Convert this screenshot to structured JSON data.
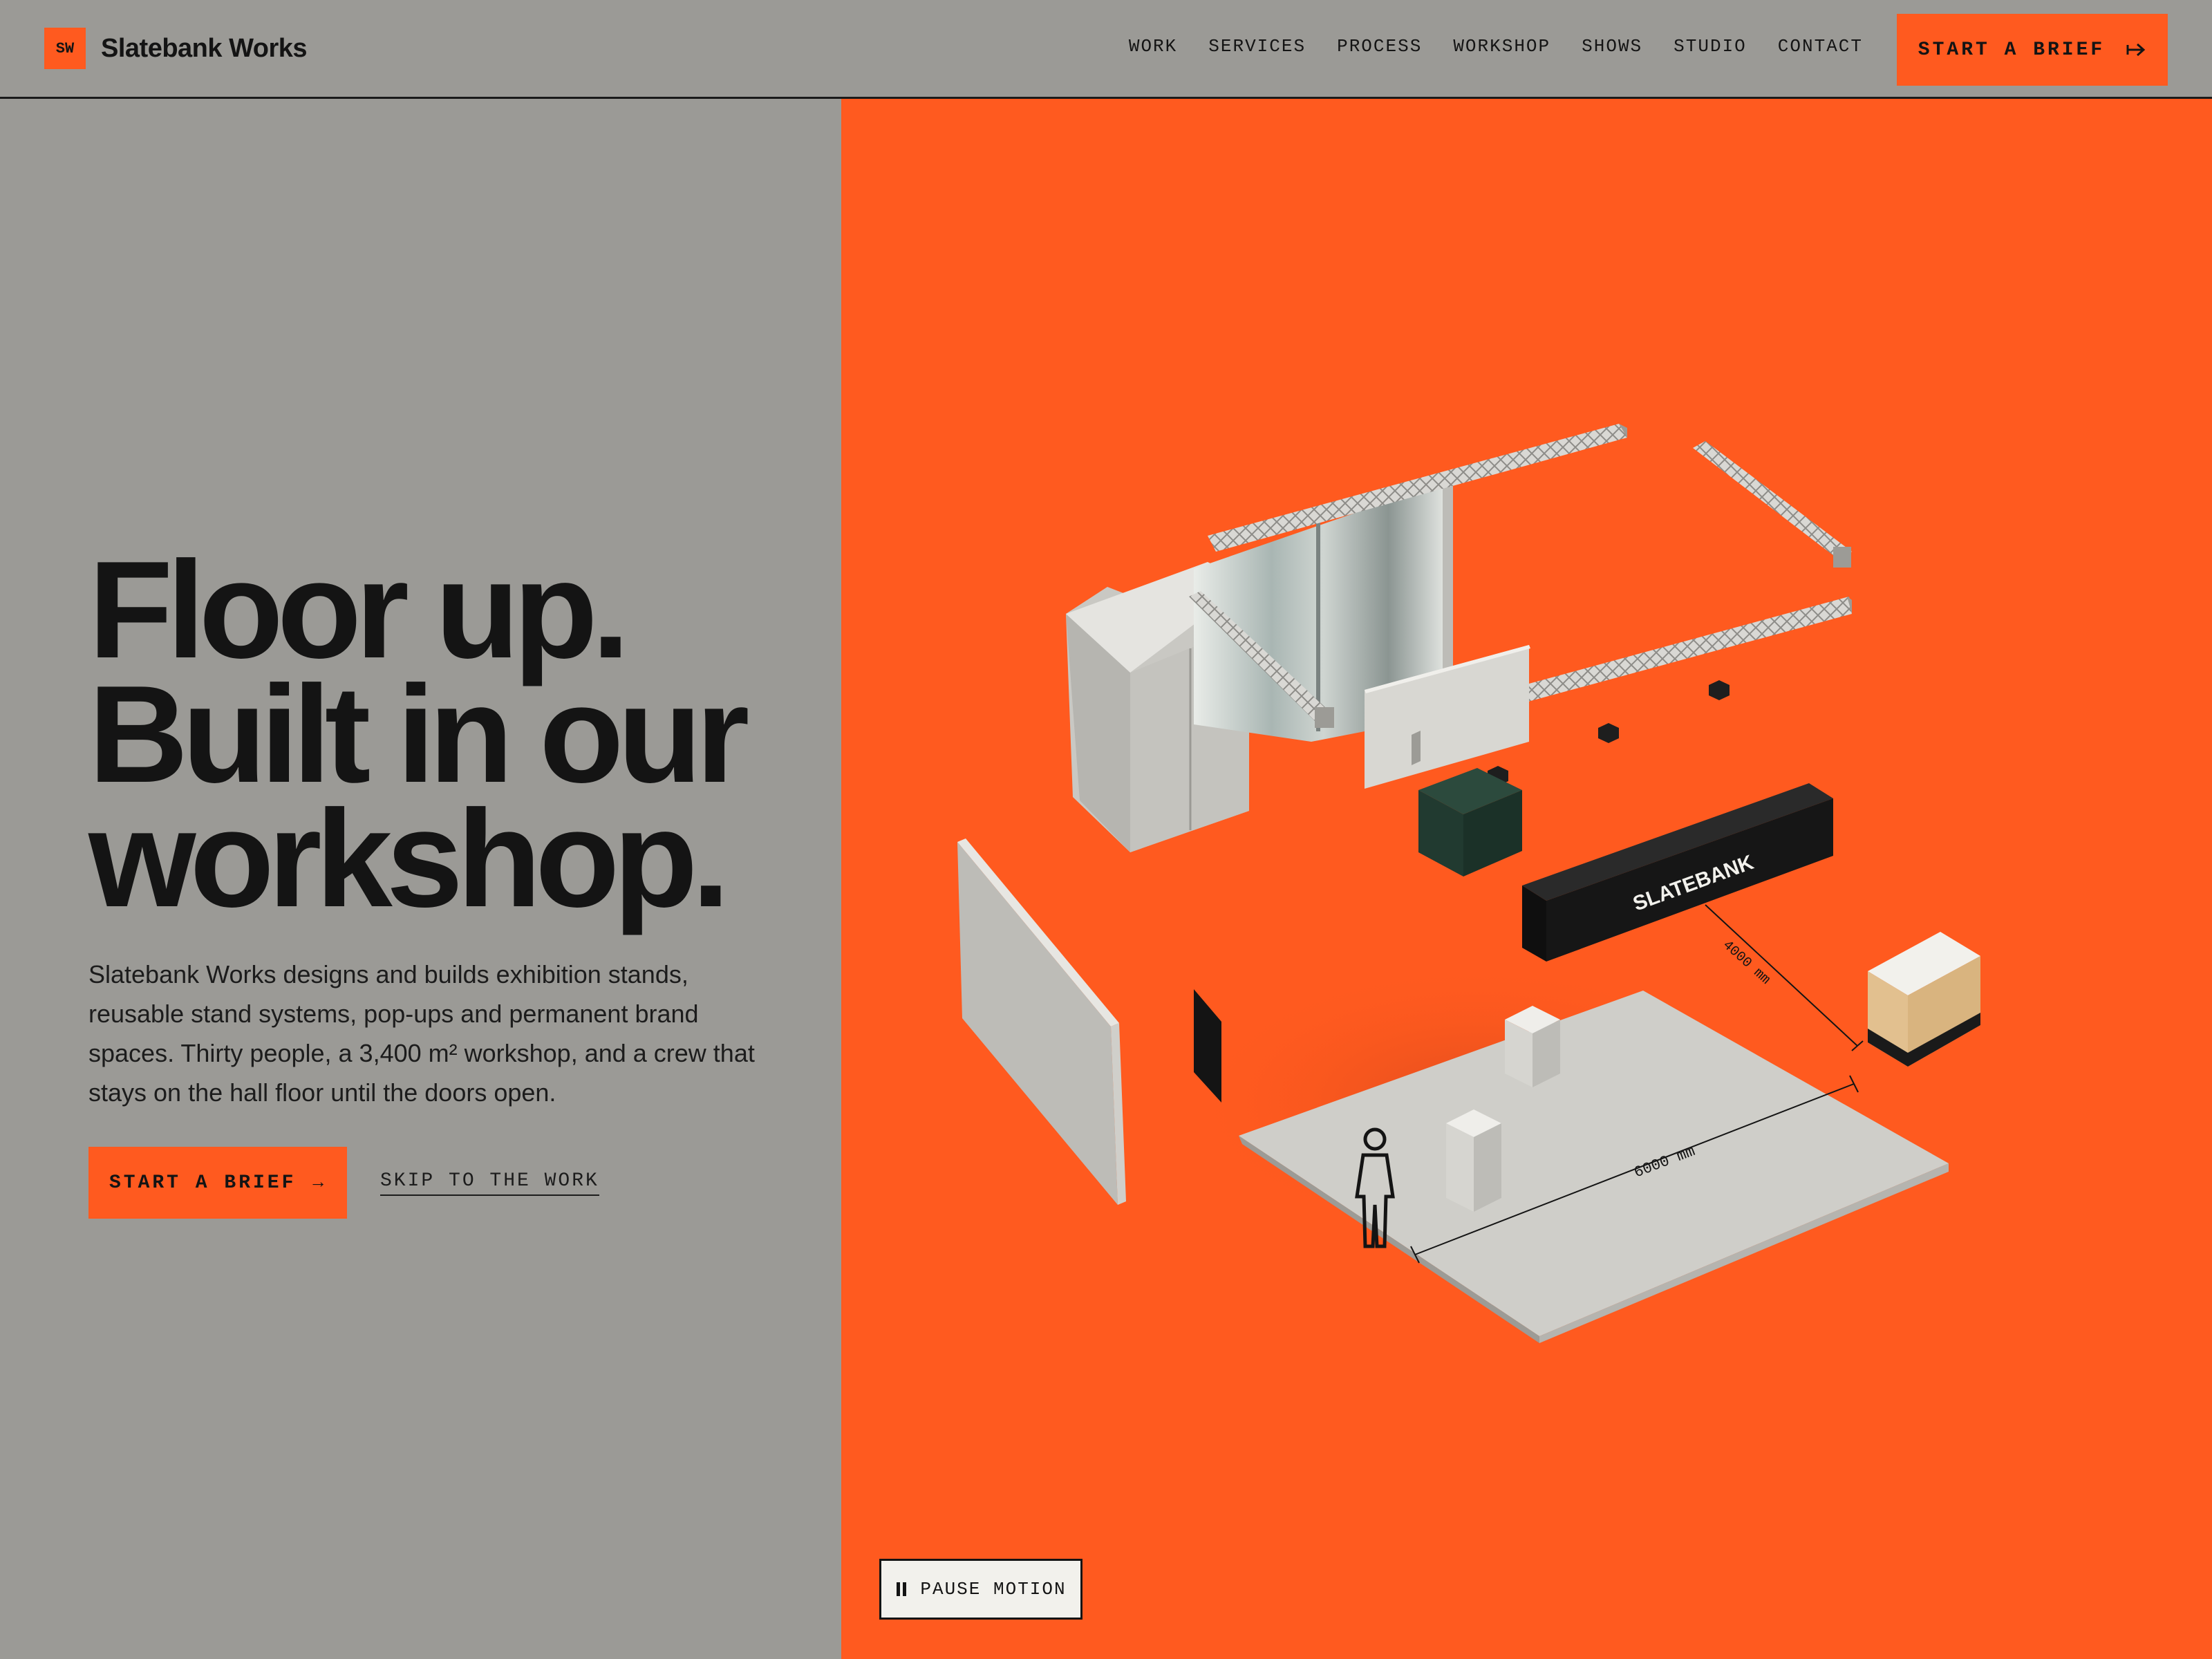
{
  "brand": {
    "mark": "SW",
    "name": "Slatebank Works"
  },
  "nav": {
    "items": [
      {
        "label": "WORK"
      },
      {
        "label": "SERVICES"
      },
      {
        "label": "PROCESS"
      },
      {
        "label": "WORKSHOP"
      },
      {
        "label": "SHOWS"
      },
      {
        "label": "STUDIO"
      },
      {
        "label": "CONTACT"
      }
    ],
    "cta_label": "START A BRIEF"
  },
  "hero": {
    "headline": [
      "Floor up.",
      "Built in our",
      "workshop."
    ],
    "lede": "Slatebank Works designs and builds exhibition stands, reusable stand systems, pop-ups and permanent brand spaces. Thirty people, a 3,400 m² workshop, and a crew that stays on the hall floor until the doors open.",
    "primary_cta": "START A BRIEF",
    "primary_cta_arrow": "→",
    "secondary_cta": "SKIP TO THE WORK"
  },
  "visual": {
    "counter_label": "SLATEBANK",
    "dimension_depth": "4000 mm",
    "dimension_width": "6000 mm",
    "colors": {
      "accent": "#ff5a1f",
      "panel": "#c9c8c3",
      "counter": "#141414",
      "plinth": "#233a30",
      "wood": "#e2c08f"
    }
  },
  "motion": {
    "pause_label": "PAUSE MOTION"
  }
}
